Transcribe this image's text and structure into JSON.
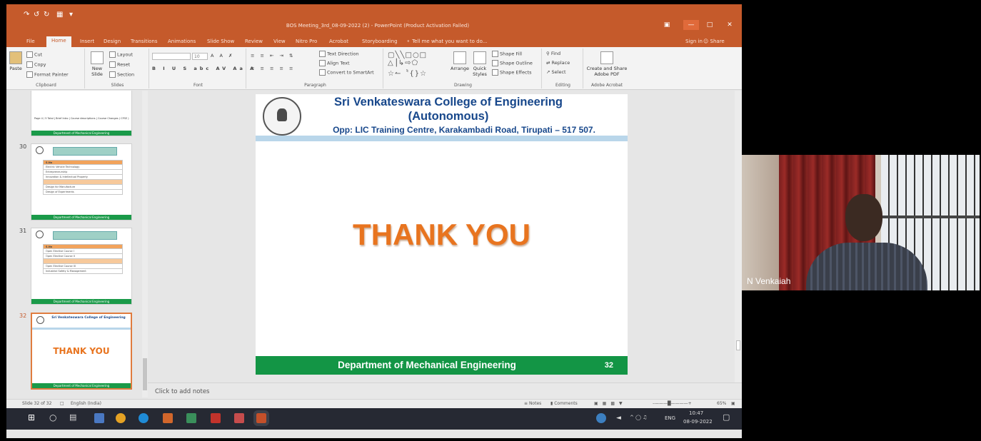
{
  "window": {
    "title": "BOS Meeting_3rd_08-09-2022 (2) - PowerPoint (Product Activation Failed)",
    "sign_in": "Sign in",
    "share": "Share"
  },
  "tabs": [
    "File",
    "Home",
    "Insert",
    "Design",
    "Transitions",
    "Animations",
    "Slide Show",
    "Review",
    "View",
    "Nitro Pro",
    "Acrobat",
    "Storyboarding",
    "Tell me what you want to do..."
  ],
  "ribbon": {
    "clipboard": {
      "paste": "Paste",
      "cut": "Cut",
      "copy": "Copy",
      "format_painter": "Format Painter",
      "label": "Clipboard"
    },
    "slides": {
      "new_slide": "New Slide",
      "layout": "Layout",
      "reset": "Reset",
      "section": "Section",
      "label": "Slides"
    },
    "font": {
      "size": "10",
      "label": "Font"
    },
    "paragraph": {
      "text_direction": "Text Direction",
      "align_text": "Align Text",
      "smartart": "Convert to SmartArt",
      "label": "Paragraph"
    },
    "drawing": {
      "arrange": "Arrange",
      "quick_styles": "Quick Styles",
      "shape_fill": "Shape Fill",
      "shape_outline": "Shape Outline",
      "shape_effects": "Shape Effects",
      "label": "Drawing"
    },
    "editing": {
      "find": "Find",
      "replace": "Replace",
      "select": "Select",
      "label": "Editing"
    },
    "acrobat": {
      "create": "Create and Share Adobe PDF",
      "label": "Adobe Acrobat"
    }
  },
  "thumbs": {
    "top_caption": "Page 4 / 5 Total | Brief Intro | Course descriptions | Course Changes ( CFSE )",
    "footer": "Department of Mechanical Engineering",
    "s30": {
      "num": "30",
      "rows": [
        "S.No",
        "Electric Vehicle Technology",
        "Entrepreneurship",
        "Innovation & Intellectual Property",
        "Design for Manufacture",
        "Design of Experiments"
      ]
    },
    "s31": {
      "num": "31",
      "rows": [
        "S.No",
        "Open Elective Course I",
        "Open Elective Course II",
        "Open Elective Course III",
        "Industrial Safety & Management"
      ]
    },
    "s32": {
      "num": "32",
      "college": "Sri Venkateswara College of Engineering",
      "thanks": "THANK YOU"
    }
  },
  "slide": {
    "title1": "Sri Venkateswara College of Engineering",
    "title2": "(Autonomous)",
    "address": "Opp: LIC Training Centre, Karakambadi Road, Tirupati – 517 507.",
    "thanks": "THANK YOU",
    "footer": "Department of Mechanical Engineering",
    "number": "32"
  },
  "notes": {
    "placeholder": "Click to add notes"
  },
  "status": {
    "slide": "Slide 32 of 32",
    "lang": "English (India)",
    "notes": "Notes",
    "comments": "Comments",
    "zoom": "65%"
  },
  "taskbar": {
    "time": "10:47",
    "date": "08-09-2022",
    "lang": "ENG"
  },
  "camera": {
    "name": "N Venkaiah"
  }
}
